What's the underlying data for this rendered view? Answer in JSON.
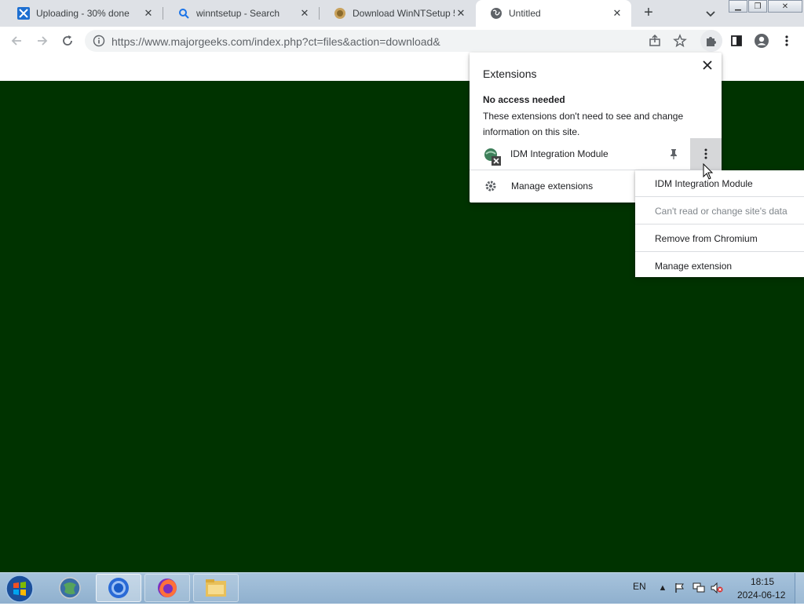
{
  "browser": {
    "tabs": [
      {
        "title": "Uploading - 30% done",
        "favicon": "upload-x-icon",
        "active": false
      },
      {
        "title": "winntsetup - Search",
        "favicon": "search-icon",
        "active": false
      },
      {
        "title": "Download WinNTSetup 5",
        "favicon": "majorgeeks-icon",
        "active": false
      },
      {
        "title": "Untitled",
        "favicon": "globe-icon",
        "active": true
      }
    ],
    "address_url": "https://www.majorgeeks.com/index.php?ct=files&action=download&"
  },
  "extensions_popup": {
    "title": "Extensions",
    "section_heading": "No access needed",
    "section_description": "These extensions don't need to see and change information on this site.",
    "extension_name": "IDM Integration Module",
    "manage_label": "Manage extensions"
  },
  "context_menu": {
    "items": [
      {
        "label": "IDM Integration Module",
        "enabled": true
      },
      {
        "label": "Can't read or change site's data",
        "enabled": false
      },
      {
        "label": "Remove from Chromium",
        "enabled": true
      },
      {
        "label": "Manage extension",
        "enabled": true
      }
    ]
  },
  "page": {
    "background_color": "#003300"
  },
  "taskbar": {
    "language": "EN",
    "time": "18:15",
    "date": "2024-06-12"
  }
}
